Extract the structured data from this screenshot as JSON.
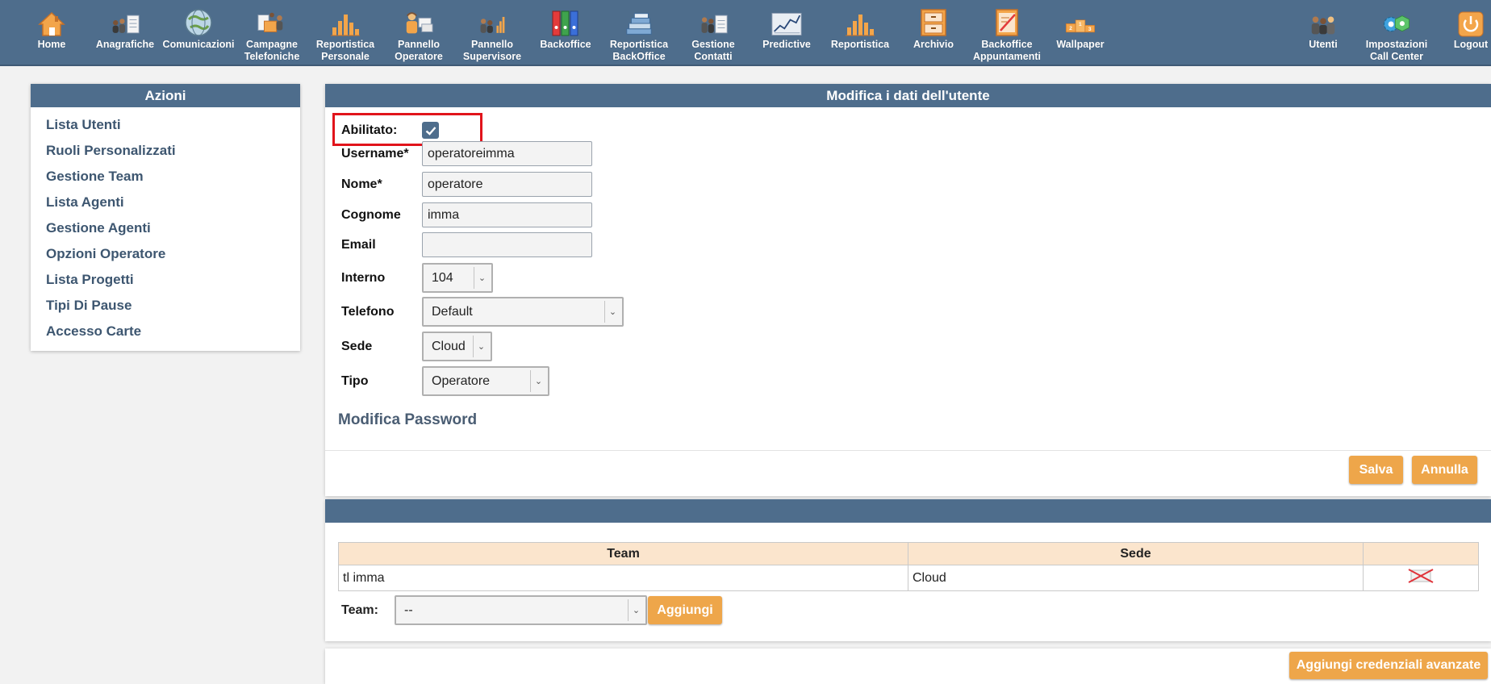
{
  "toolbar": {
    "items": [
      {
        "label": "Home",
        "icon": "home-icon"
      },
      {
        "label": "Anagrafiche",
        "icon": "people-doc-icon"
      },
      {
        "label": "Comunicazioni",
        "icon": "globe-icon"
      },
      {
        "label": "Campagne\nTelefoniche",
        "icon": "campaign-icon"
      },
      {
        "label": "Reportistica\nPersonale",
        "icon": "bar-chart-icon"
      },
      {
        "label": "Pannello\nOperatore",
        "icon": "operator-icon"
      },
      {
        "label": "Pannello\nSupervisore",
        "icon": "supervisor-icon"
      },
      {
        "label": "Backoffice",
        "icon": "binders-icon"
      },
      {
        "label": "Reportistica\nBackOffice",
        "icon": "books-icon"
      },
      {
        "label": "Gestione\nContatti",
        "icon": "contacts-icon"
      },
      {
        "label": "Predictive",
        "icon": "line-chart-icon"
      },
      {
        "label": "Reportistica",
        "icon": "bar-chart-icon"
      },
      {
        "label": "Archivio",
        "icon": "cabinet-icon"
      },
      {
        "label": "Backoffice\nAppuntamenti",
        "icon": "calendar-icon"
      },
      {
        "label": "Wallpaper",
        "icon": "podium-icon"
      }
    ],
    "right_items": [
      {
        "label": "Utenti",
        "icon": "users-icon"
      },
      {
        "label": "Impostazioni\nCall Center",
        "icon": "settings-gears-icon"
      },
      {
        "label": "Logout",
        "icon": "power-icon"
      }
    ]
  },
  "sidebar": {
    "title": "Azioni",
    "items": [
      {
        "label": "Lista Utenti"
      },
      {
        "label": "Ruoli Personalizzati"
      },
      {
        "label": "Gestione Team"
      },
      {
        "label": "Lista Agenti"
      },
      {
        "label": "Gestione Agenti"
      },
      {
        "label": "Opzioni Operatore"
      },
      {
        "label": "Lista Progetti"
      },
      {
        "label": "Tipi Di Pause"
      },
      {
        "label": "Accesso Carte"
      }
    ]
  },
  "form": {
    "title": "Modifica i dati dell'utente",
    "enabled_label": "Abilitato:",
    "enabled_checked": true,
    "username_label": "Username*",
    "username_value": "operatoreimma",
    "nome_label": "Nome*",
    "nome_value": "operatore",
    "cognome_label": "Cognome",
    "cognome_value": "imma",
    "email_label": "Email",
    "email_value": "",
    "interno_label": "Interno",
    "interno_value": "104",
    "telefono_label": "Telefono",
    "telefono_value": "Default",
    "sede_label": "Sede",
    "sede_value": "Cloud",
    "tipo_label": "Tipo",
    "tipo_value": "Operatore",
    "password_section": "Modifica Password",
    "save_label": "Salva",
    "cancel_label": "Annulla"
  },
  "team": {
    "columns": [
      "Team",
      "Sede",
      ""
    ],
    "rows": [
      {
        "team": "tl imma",
        "sede": "Cloud"
      }
    ],
    "team_label": "Team:",
    "team_select_value": "--",
    "add_label": "Aggiungi"
  },
  "advanced": {
    "add_credentials_label": "Aggiungi credenziali avanzate"
  },
  "colors": {
    "header_blue": "#4e6d8c",
    "button_orange": "#eea64a",
    "table_header": "#fbe5cd",
    "highlight_red": "#e1141b"
  }
}
